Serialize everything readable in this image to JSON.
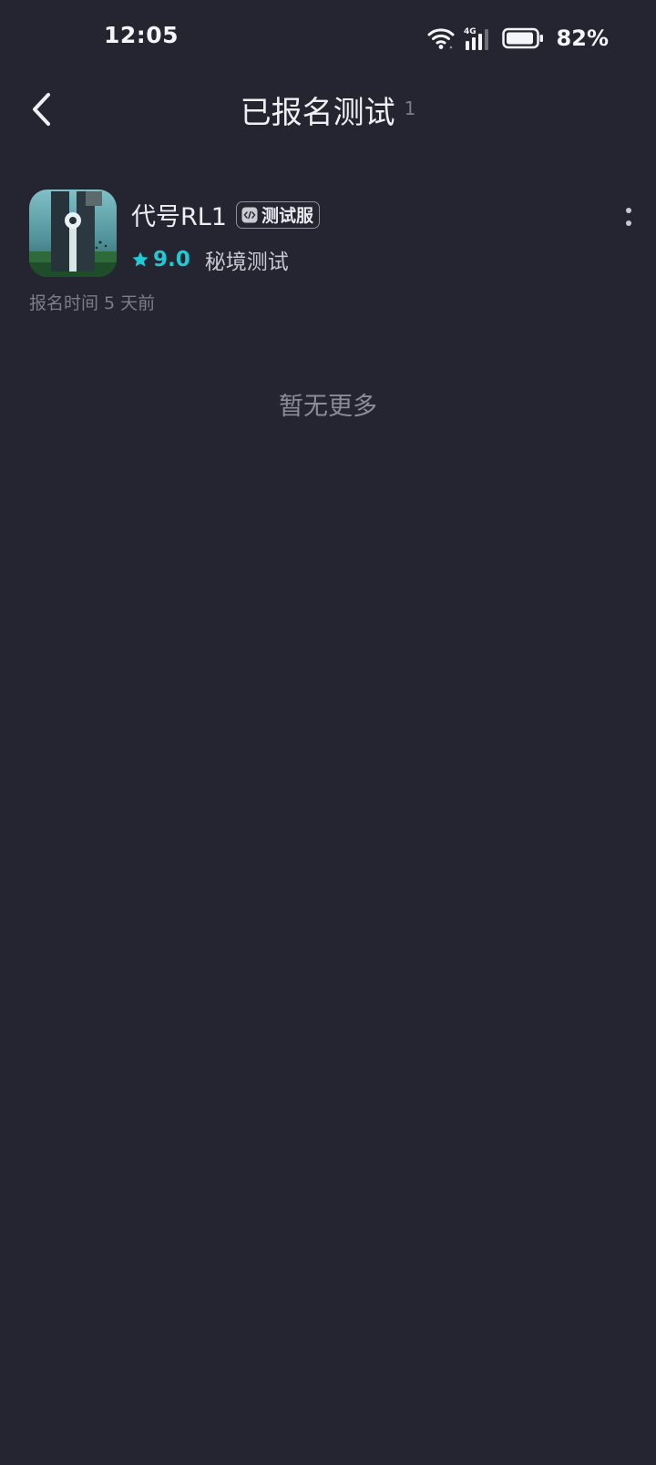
{
  "status_bar": {
    "time": "12:05",
    "network": "4G",
    "battery": "82%"
  },
  "header": {
    "title": "已报名测试",
    "count": "1",
    "back_icon": "chevron-left-icon"
  },
  "game": {
    "name": "代号RL1",
    "badge_label": "测试服",
    "badge_icon": "code-icon",
    "rating": "9.0",
    "test_type": "秘境测试",
    "signup_time": "报名时间 5 天前",
    "more_icon": "more-vertical-icon"
  },
  "list_end_text": "暂无更多",
  "colors": {
    "background": "#242531",
    "accent": "#1fc9d6",
    "text_primary": "#eceef3",
    "text_secondary": "#7b7d88"
  }
}
